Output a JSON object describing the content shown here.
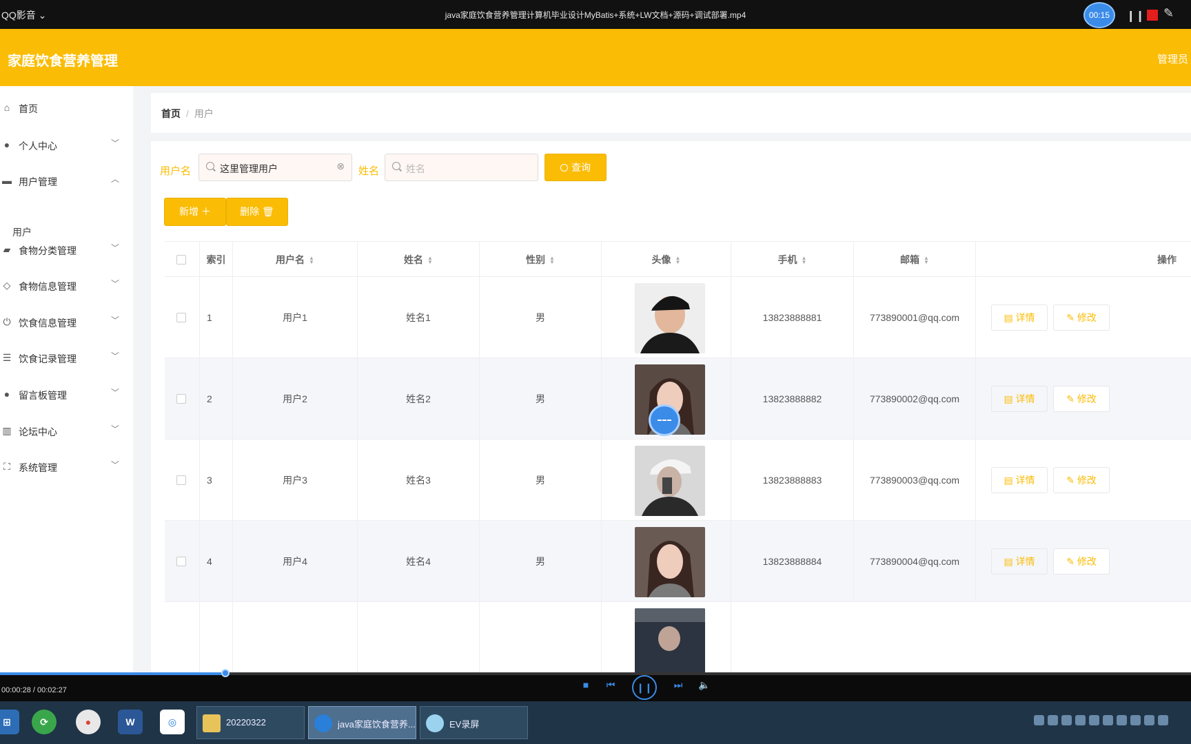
{
  "player": {
    "app_name": "QQ影音",
    "title": "java家庭饮食营养管理计算机毕业设计MyBatis+系统+LW文档+源码+调试部署.mp4",
    "rec_time": "00:15",
    "time_display": "00:00:28 / 00:02:27",
    "progress_fraction": 0.19
  },
  "app": {
    "brand": "家庭饮食营养管理",
    "role": "管理员"
  },
  "sidebar": {
    "items": [
      {
        "label": "首页",
        "icon": "home-icon"
      },
      {
        "label": "个人中心",
        "icon": "user-icon"
      },
      {
        "label": "用户管理",
        "icon": "folder-icon",
        "expanded": true
      },
      {
        "label": "食物分类管理",
        "icon": "ticket-icon"
      },
      {
        "label": "食物信息管理",
        "icon": "bell-icon"
      },
      {
        "label": "饮食信息管理",
        "icon": "power-icon"
      },
      {
        "label": "饮食记录管理",
        "icon": "list-icon"
      },
      {
        "label": "留言板管理",
        "icon": "bulb-icon"
      },
      {
        "label": "论坛中心",
        "icon": "building-icon"
      },
      {
        "label": "系统管理",
        "icon": "fullscreen-icon"
      }
    ],
    "sub_item": "用户"
  },
  "breadcrumb": {
    "home": "首页",
    "sep": "/",
    "current": "用户"
  },
  "search": {
    "username_label": "用户名",
    "username_value": "这里管理用户",
    "name_label": "姓名",
    "name_placeholder": "姓名",
    "query_button": "查询"
  },
  "actions": {
    "add": "新增 ＋",
    "delete": "删除 🗑"
  },
  "table": {
    "headers": {
      "index": "索引",
      "username": "用户名",
      "name": "姓名",
      "gender": "性别",
      "avatar": "头像",
      "phone": "手机",
      "email": "邮箱",
      "ops": "操作"
    },
    "detail_label": "详情",
    "edit_label": "修改",
    "rows": [
      {
        "index": "1",
        "username": "用户1",
        "name": "姓名1",
        "gender": "男",
        "phone": "13823888881",
        "email": "773890001@qq.com"
      },
      {
        "index": "2",
        "username": "用户2",
        "name": "姓名2",
        "gender": "男",
        "phone": "13823888882",
        "email": "773890002@qq.com"
      },
      {
        "index": "3",
        "username": "用户3",
        "name": "姓名3",
        "gender": "男",
        "phone": "13823888883",
        "email": "773890003@qq.com"
      },
      {
        "index": "4",
        "username": "用户4",
        "name": "姓名4",
        "gender": "男",
        "phone": "13823888884",
        "email": "773890004@qq.com"
      }
    ]
  },
  "taskbar": {
    "windows": [
      {
        "label": "20220322"
      },
      {
        "label": "java家庭饮食营养..."
      },
      {
        "label": "EV录屏"
      }
    ]
  },
  "colors": {
    "accent": "#fbbc05",
    "player_blue": "#3b8be8"
  }
}
